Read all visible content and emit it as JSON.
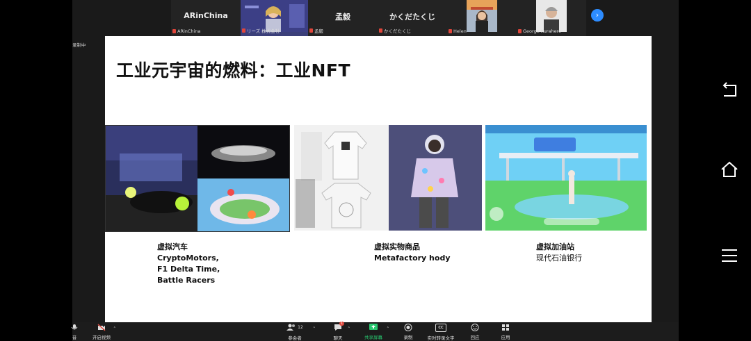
{
  "participants": [
    {
      "name": "ARinChina",
      "label": "ARinChina",
      "muted": true,
      "video": false
    },
    {
      "name": "",
      "label": "リーズ 株式会社",
      "muted": true,
      "video": true
    },
    {
      "name": "孟毅",
      "label": "孟毅",
      "muted": true,
      "video": false
    },
    {
      "name": "かくだたくじ",
      "label": "かくだたくじ",
      "muted": true,
      "video": false
    },
    {
      "name": "",
      "label": "Helen",
      "muted": true,
      "video": true
    },
    {
      "name": "",
      "label": "George Kurahero",
      "muted": true,
      "video": true
    }
  ],
  "recording": {
    "label": "录制中"
  },
  "slide": {
    "title": "工业元宇宙的燃料：工业NFT",
    "captions": [
      {
        "line1": "虚拟汽车",
        "line2": "CryptoMotors,",
        "line3": "F1 Delta Time,",
        "line4": "Battle Racers"
      },
      {
        "line1": "虚拟实物商品",
        "line2": "Metafactory hody"
      },
      {
        "line1": "虚拟加油站",
        "line2": "现代石油银行"
      }
    ]
  },
  "toolbar": {
    "audio_label": "音",
    "video_label": "开启视频",
    "participants_label": "参会者",
    "participants_count": "12",
    "chat_label": "聊天",
    "chat_badge": "1",
    "share_label": "共享屏幕",
    "record_label": "录制",
    "captions_label": "实时转录文字",
    "reactions_label": "回应",
    "apps_label": "应用",
    "cc_text": "CC"
  },
  "colors": {
    "accent": "#2d8cff",
    "share_green": "#28c76f",
    "muted_red": "#e0463b"
  }
}
